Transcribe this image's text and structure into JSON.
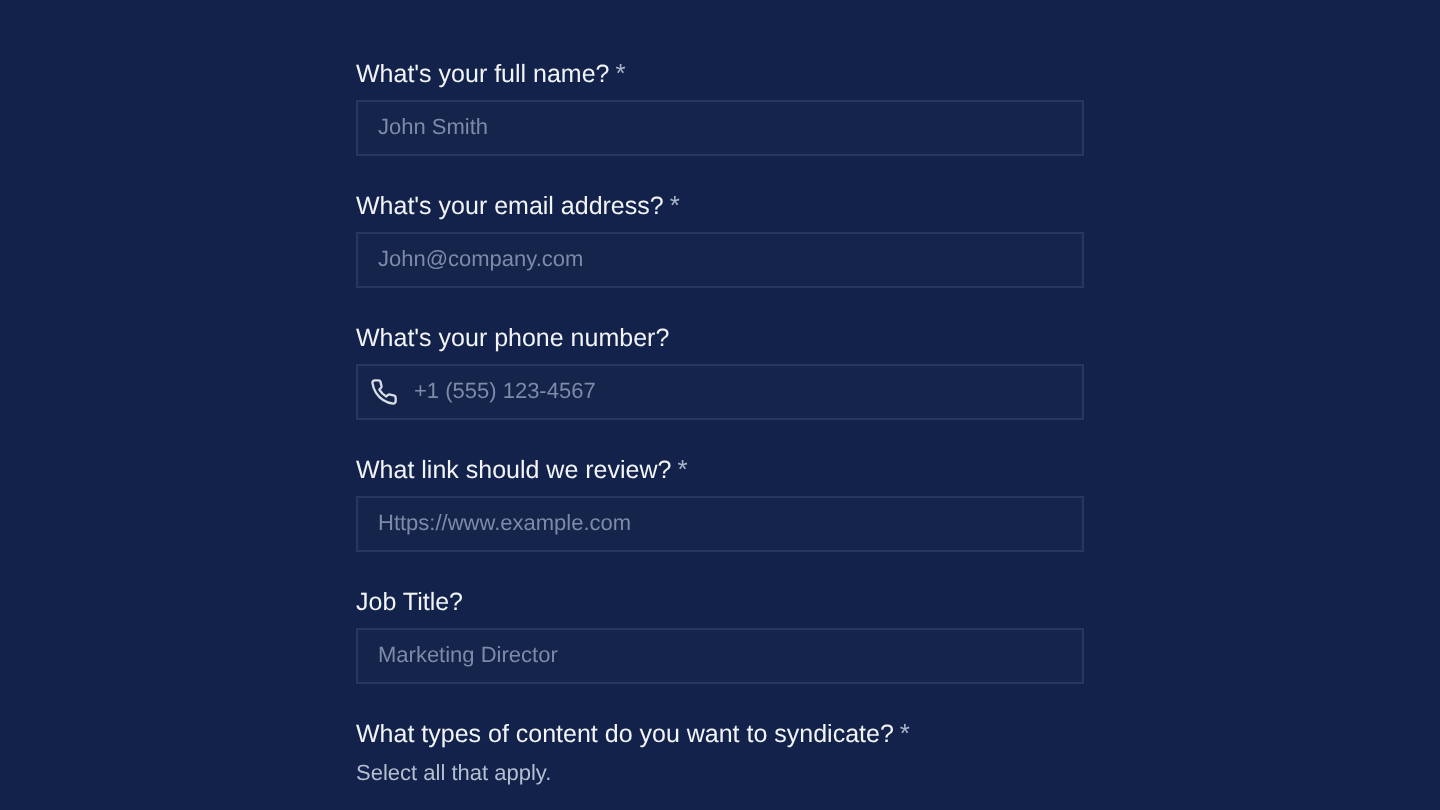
{
  "fields": [
    {
      "kind": "text",
      "label": "What's your full name?",
      "required_mark": "*",
      "placeholder": "John Smith"
    },
    {
      "kind": "text",
      "label": "What's your email address?",
      "required_mark": "*",
      "placeholder": "John@company.com"
    },
    {
      "kind": "phone",
      "label": "What's your phone number?",
      "placeholder": "+1 (555) 123-4567"
    },
    {
      "kind": "text",
      "label": "What link should we review?",
      "required_mark": "*",
      "placeholder": "Https://www.example.com"
    },
    {
      "kind": "text",
      "label": "Job Title?",
      "placeholder": "Marketing Director"
    },
    {
      "kind": "group",
      "label": "What types of content do you want to syndicate?",
      "required_mark": "*",
      "hint": "Select all that apply."
    }
  ]
}
